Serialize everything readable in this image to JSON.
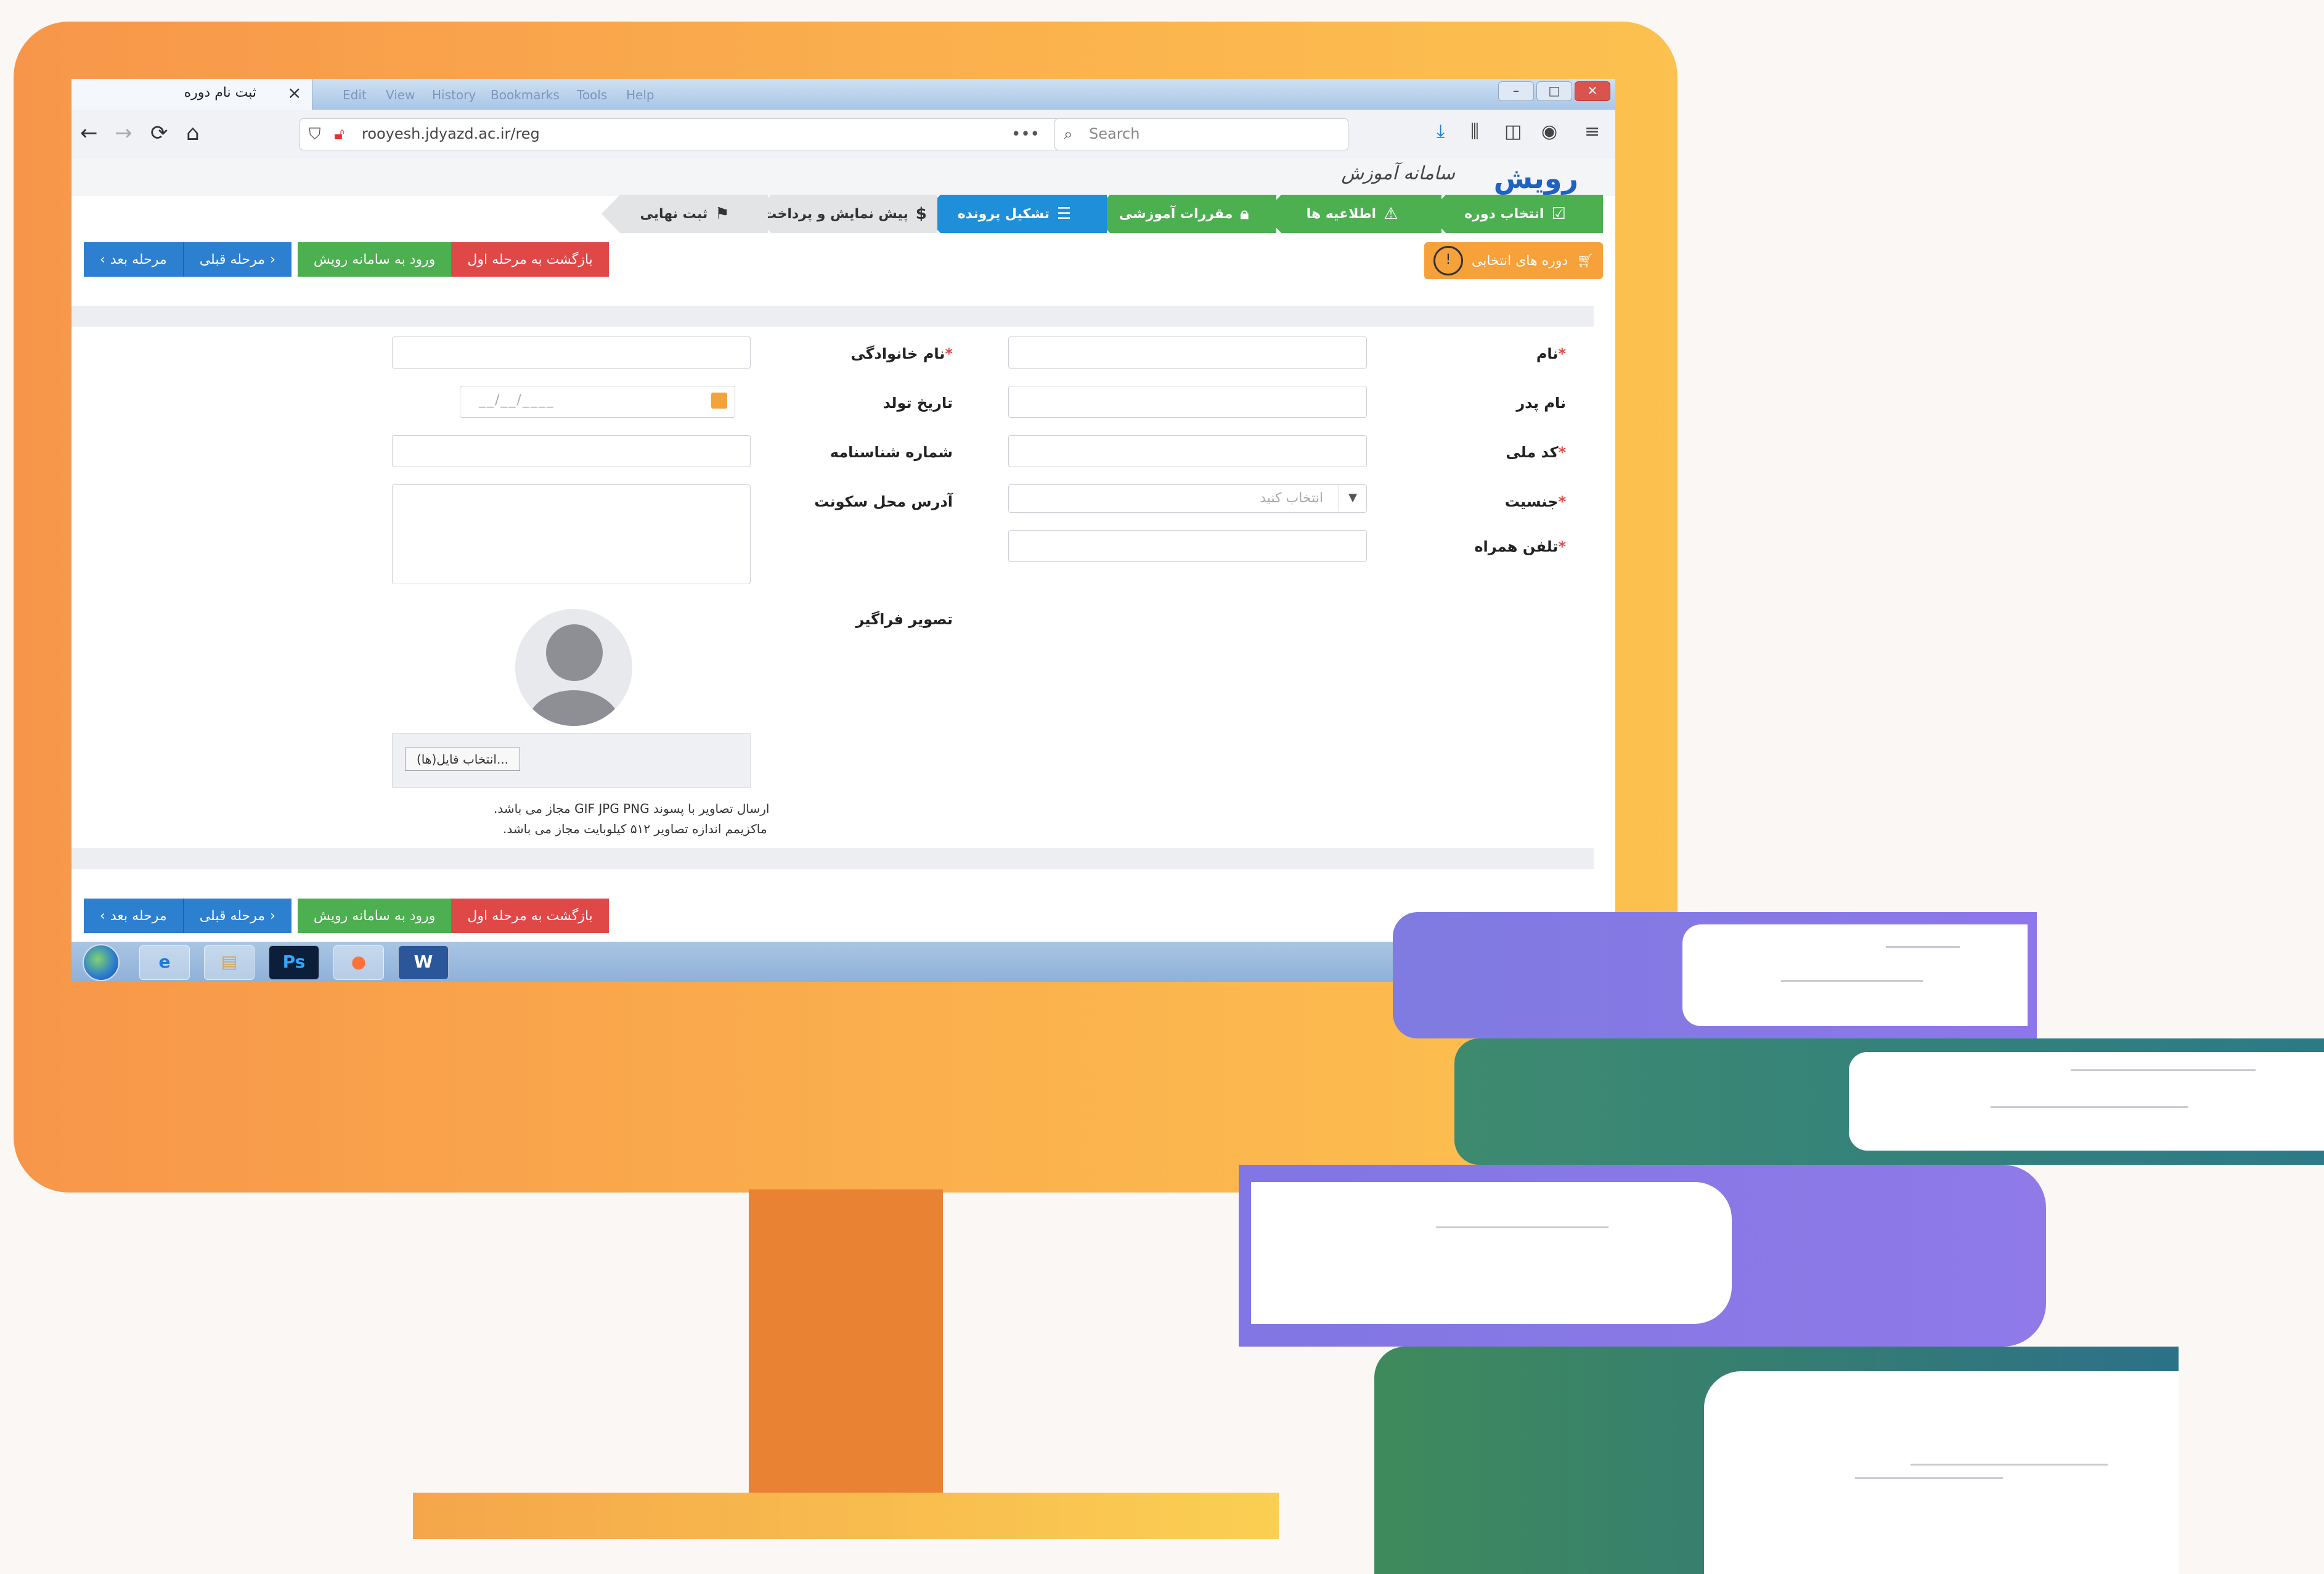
{
  "browser": {
    "tab_title": "ثبت نام دوره",
    "tab_close": "×",
    "menu_items": [
      "Edit",
      "View",
      "History",
      "Bookmarks",
      "Tools",
      "Help"
    ],
    "window_buttons": [
      "–",
      "□",
      "✕"
    ],
    "url": "rooyesh.jdyazd.ac.ir/reg",
    "url_more": "•••",
    "search_placeholder": "Search"
  },
  "site": {
    "logo_text": "رویش",
    "logo_subtitle": "سامانه آموزش"
  },
  "steps": [
    {
      "label": "انتخاب دوره",
      "state": "done",
      "color": "#4caf50",
      "icon": "check-square-icon"
    },
    {
      "label": "اطلاعیه ها",
      "state": "done",
      "color": "#4caf50",
      "icon": "warning-icon"
    },
    {
      "label": "مقررات آموزشی",
      "state": "done",
      "color": "#4caf50",
      "icon": "lock-icon"
    },
    {
      "label": "تشکیل پرونده",
      "state": "active",
      "color": "#1e8fd8",
      "icon": "list-icon"
    },
    {
      "label": "پیش نمایش و پرداخت",
      "state": "pending",
      "color": "#e3e4e6",
      "icon": "dollar-icon"
    },
    {
      "label": "ثبت نهایی",
      "state": "pending",
      "color": "#e3e4e6",
      "icon": "flag-icon"
    }
  ],
  "actions": {
    "next": "مرحله بعد",
    "prev": "مرحله قبلی",
    "login": "ورود به سامانه رویش",
    "back_first": "بازگشت به مرحله اول",
    "selected_courses": "دوره های انتخابی"
  },
  "form": {
    "first_name": "نام",
    "last_name": "نام خانوادگی",
    "father_name": "نام پدر",
    "birth_date": "تاریخ تولد",
    "birth_date_placeholder": "__/__/____",
    "national_code": "کد ملی",
    "id_number": "شماره شناسنامه",
    "gender": "جنسیت",
    "gender_placeholder": "انتخاب کنید",
    "address": "آدرس محل سکونت",
    "mobile": "تلفن همراه",
    "photo": "تصویر فراگیر",
    "choose_file": "انتخاب فایل(ها)...",
    "note_line1": "ارسال تصاویر با پسوند GIF JPG PNG مجاز می باشد.",
    "note_line2": "ماکزیمم اندازه تصاویر ۵۱۲ کیلوبایت مجاز می باشد."
  },
  "taskbar": {
    "items": [
      {
        "name": "ie-icon",
        "glyph": "e"
      },
      {
        "name": "explorer-icon",
        "glyph": "▤"
      },
      {
        "name": "photoshop-icon",
        "glyph": "Ps"
      },
      {
        "name": "firefox-icon",
        "glyph": "●"
      },
      {
        "name": "word-icon",
        "glyph": "W"
      }
    ]
  },
  "colors": {
    "monitor": "#f7964a",
    "active_step": "#1e8fd8",
    "done_step": "#4caf50",
    "danger": "#e04848",
    "accent": "#f7a13a"
  }
}
